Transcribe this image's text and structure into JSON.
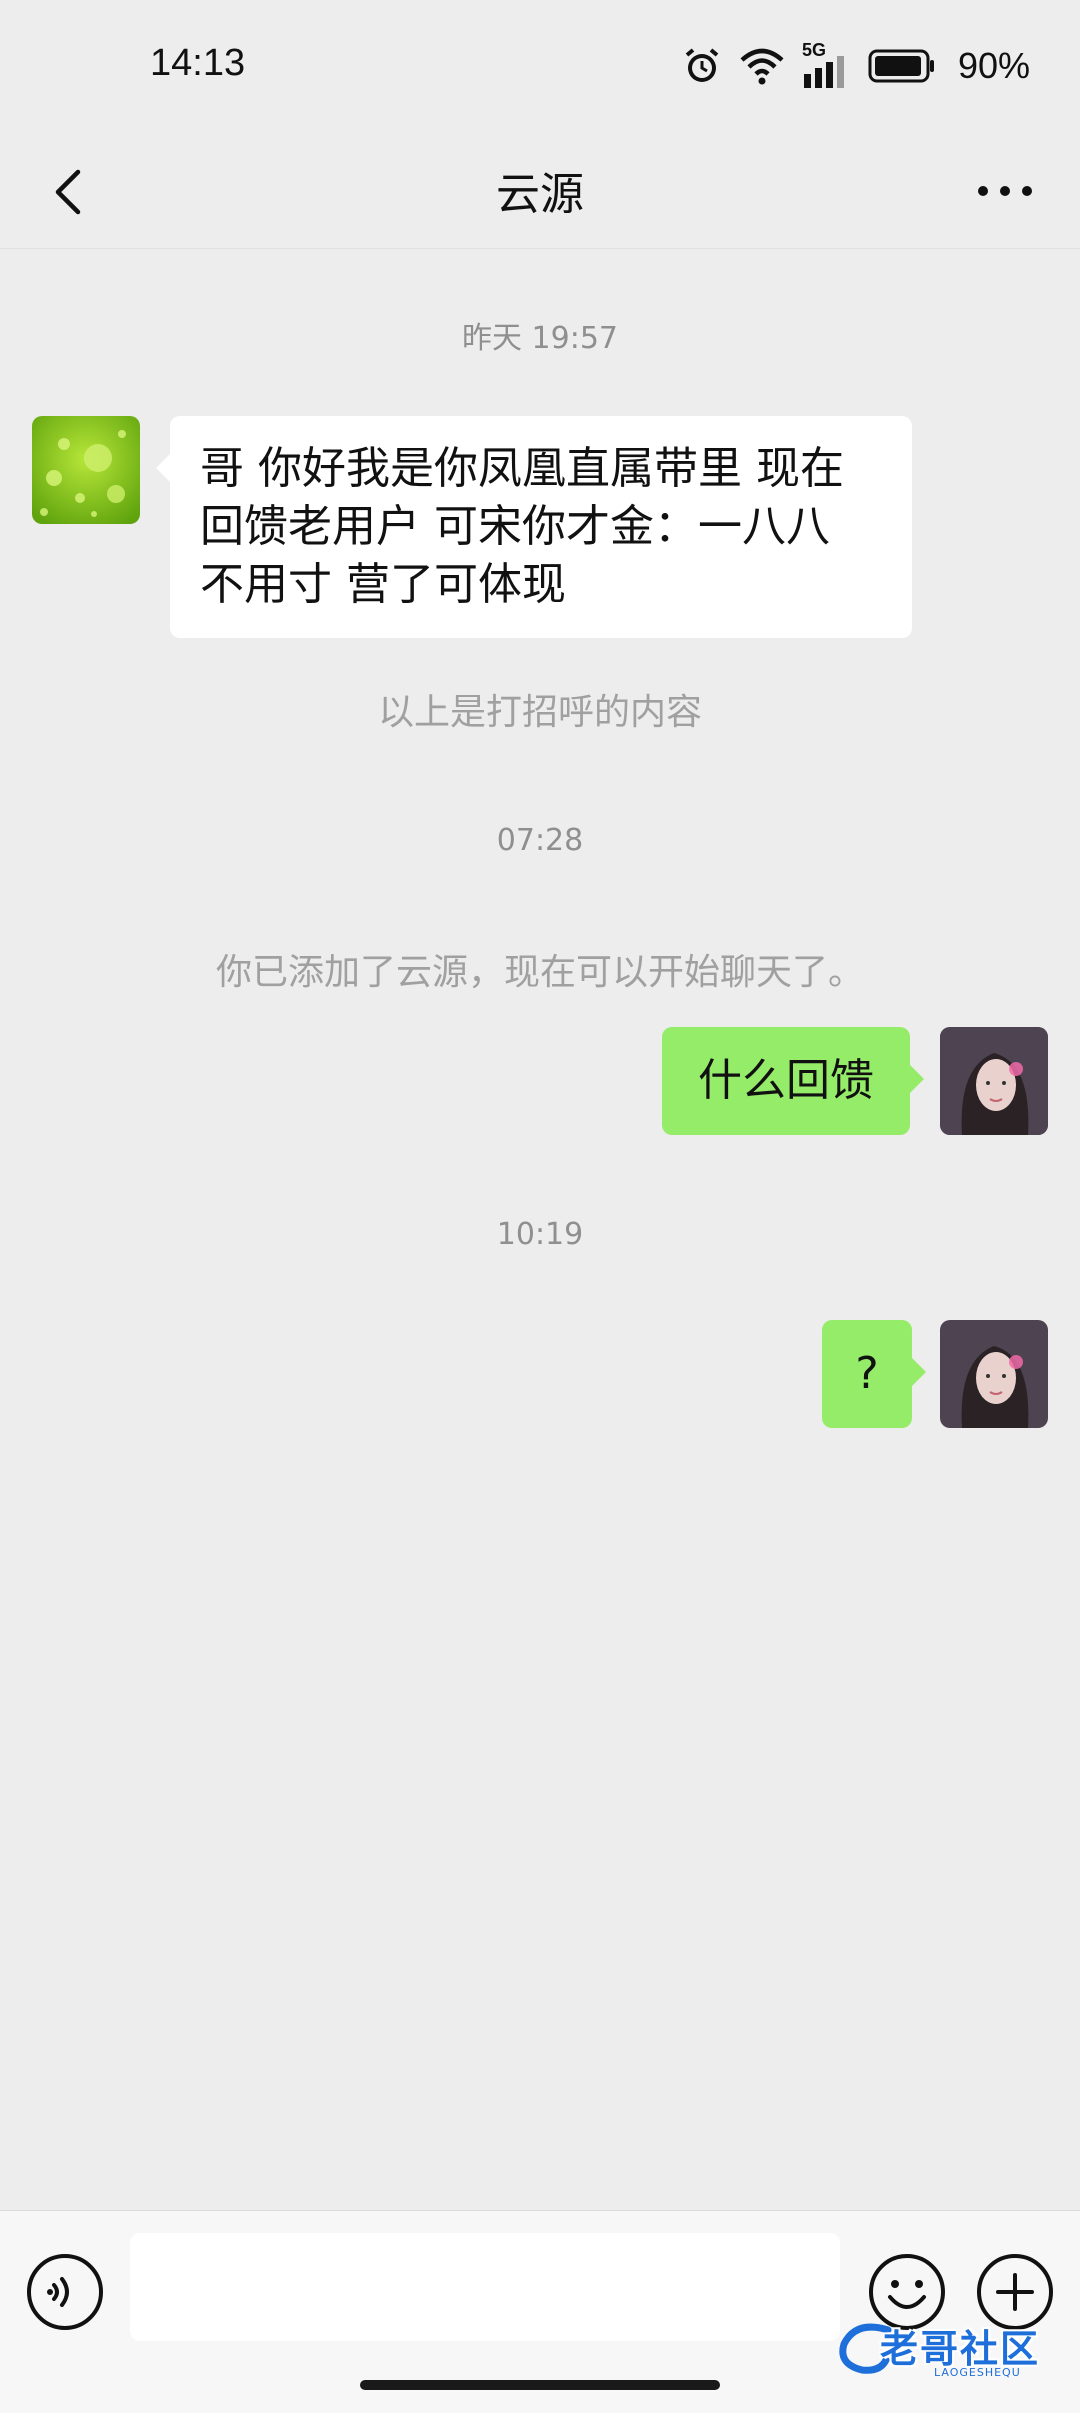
{
  "status_bar": {
    "time": "14:13",
    "network": "5G",
    "battery": "90%",
    "icons": [
      "alarm-icon",
      "wifi-icon",
      "signal-icon",
      "battery-icon"
    ]
  },
  "header": {
    "title": "云源",
    "back_icon": "chevron-left-icon",
    "more_icon": "more-dots-icon"
  },
  "messages": {
    "timestamp_1": "昨天 19:57",
    "incoming_1_lines": [
      "哥 你好我是你凤凰直属带里 现在",
      "回馈老用户 可宋你才金：一八八",
      "不用寸 营了可体现"
    ],
    "system_1": "以上是打招呼的内容",
    "timestamp_2": "07:28",
    "system_2": "你已添加了云源，现在可以开始聊天了。",
    "outgoing_1": "什么回馈",
    "timestamp_3": "10:19",
    "outgoing_2": "?"
  },
  "input_bar": {
    "value": "",
    "voice_icon": "voice-icon",
    "emoji_icon": "emoji-icon",
    "plus_icon": "plus-icon"
  },
  "watermark": {
    "text": "老哥社区",
    "sub": "LAOGESHEQU"
  },
  "colors": {
    "background": "#EDEDED",
    "outgoing_bubble": "#95EC69",
    "incoming_bubble": "#FFFFFF",
    "system_text": "#A0A0A0"
  }
}
